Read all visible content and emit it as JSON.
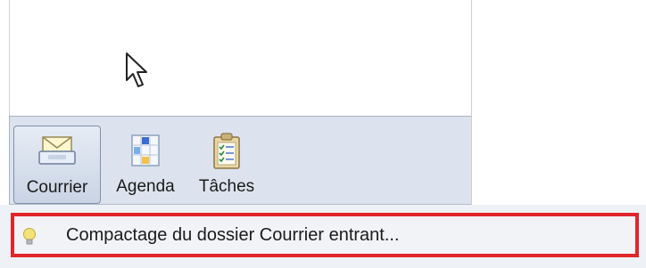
{
  "nav": {
    "modes": [
      {
        "label": "Courrier",
        "icon": "mail-icon",
        "active": true
      },
      {
        "label": "Agenda",
        "icon": "calendar-icon",
        "active": false
      },
      {
        "label": "Tâches",
        "icon": "tasks-icon",
        "active": false
      }
    ]
  },
  "status": {
    "message": "Compactage du dossier Courrier entrant...",
    "icon": "lightbulb-icon",
    "highlight_color": "#e0262a"
  },
  "colors": {
    "mode_bar_bg": "#dce3ee",
    "active_border": "#7f91ad"
  }
}
